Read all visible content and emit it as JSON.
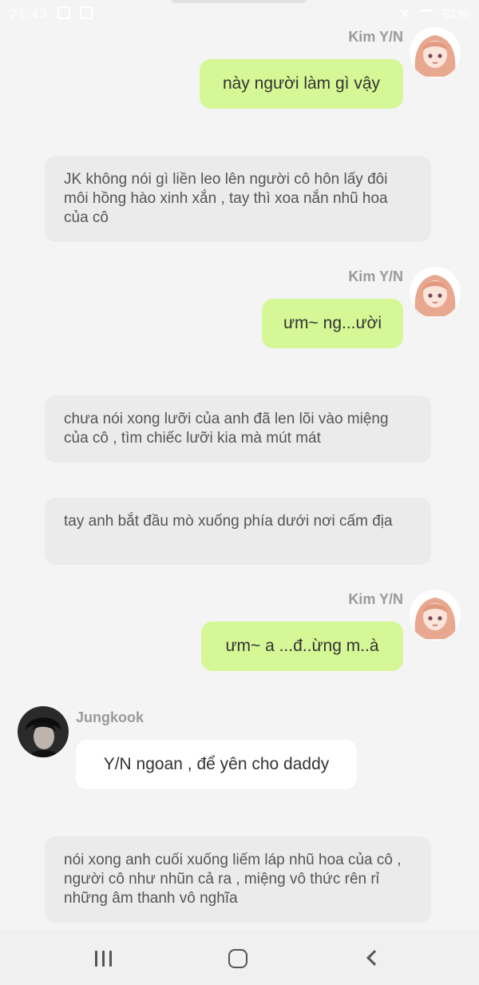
{
  "status_bar": {
    "time": "21:43",
    "battery": "81%"
  },
  "messages": [
    {
      "kind": "me",
      "sender": "Kim Y/N",
      "text": "này người làm gì vậy"
    },
    {
      "kind": "narration",
      "text": "JK không nói gì liền leo lên người cô hôn lấy đôi môi hồng hào xinh xắn , tay thì xoa nắn nhũ hoa của cô"
    },
    {
      "kind": "me",
      "sender": "Kim Y/N",
      "text": "ưm~ ng...ười"
    },
    {
      "kind": "narration",
      "text": "chưa nói xong lưỡi của anh đã len lõi vào miệng của cô , tìm chiếc lưỡi kia mà mút mát"
    },
    {
      "kind": "narration",
      "text": "tay anh bắt đầu mò xuống phía dưới nơi cấm địa"
    },
    {
      "kind": "me",
      "sender": "Kim Y/N",
      "text": "ưm~ a ...đ..ừng m..à"
    },
    {
      "kind": "other",
      "sender": "Jungkook",
      "text": "Y/N ngoan , để yên cho daddy"
    },
    {
      "kind": "narration",
      "text": "nói xong anh cuối xuống liếm láp nhũ hoa của cô , người cô như nhũn cả ra , miệng vô thức rên rỉ những âm thanh vô nghĩa"
    }
  ],
  "nav": {
    "recent_icon": "recent-apps-icon",
    "home_icon": "home-icon",
    "back_icon": "back-icon"
  }
}
